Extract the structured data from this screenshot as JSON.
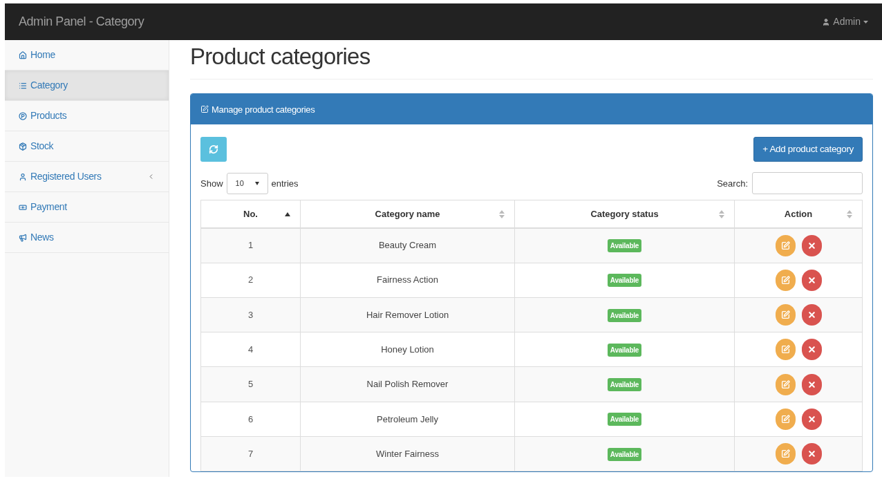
{
  "navbar": {
    "brand": "Admin Panel - Category",
    "user": "Admin"
  },
  "sidebar": {
    "items": [
      {
        "label": "Home",
        "selected": false,
        "submenu": false
      },
      {
        "label": "Category",
        "selected": true,
        "submenu": false
      },
      {
        "label": "Products",
        "selected": false,
        "submenu": false
      },
      {
        "label": "Stock",
        "selected": false,
        "submenu": false
      },
      {
        "label": "Registered Users",
        "selected": false,
        "submenu": true
      },
      {
        "label": "Payment",
        "selected": false,
        "submenu": false
      },
      {
        "label": "News",
        "selected": false,
        "submenu": false
      }
    ]
  },
  "page_title": "Product categories",
  "panel": {
    "title": "Manage product categories",
    "add_button": "+ Add product category",
    "show_label": "Show",
    "entries_value": "10",
    "entries_label": "entries",
    "search_label": "Search:"
  },
  "table": {
    "columns": [
      {
        "label": "No.",
        "sorted": true
      },
      {
        "label": "Category name",
        "sorted": false
      },
      {
        "label": "Category status",
        "sorted": false
      },
      {
        "label": "Action",
        "sorted": false
      }
    ],
    "rows": [
      {
        "no": "1",
        "name": "Beauty Cream",
        "status": "Available"
      },
      {
        "no": "2",
        "name": "Fairness Action",
        "status": "Available"
      },
      {
        "no": "3",
        "name": "Hair Remover Lotion",
        "status": "Available"
      },
      {
        "no": "4",
        "name": "Honey Lotion",
        "status": "Available"
      },
      {
        "no": "5",
        "name": "Nail Polish Remover",
        "status": "Available"
      },
      {
        "no": "6",
        "name": "Petroleum Jelly",
        "status": "Available"
      },
      {
        "no": "7",
        "name": "Winter Fairness",
        "status": "Available"
      }
    ]
  }
}
